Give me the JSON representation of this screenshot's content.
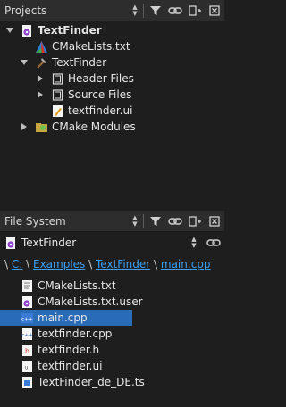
{
  "projects_toolbar": {
    "title": "Projects"
  },
  "project_tree": {
    "root": "TextFinder",
    "cmake_lists": "CMakeLists.txt",
    "target": "TextFinder",
    "header_files": "Header Files",
    "source_files": "Source Files",
    "ui_file": "textfinder.ui",
    "cmake_modules": "CMake Modules"
  },
  "fs_toolbar": {
    "title": "File System"
  },
  "fs_combo": {
    "value": "TextFinder"
  },
  "breadcrumb": {
    "root": "\\",
    "c": "C:",
    "examples": "Examples",
    "textfinder": "TextFinder",
    "file": "main.cpp",
    "sep": "\\"
  },
  "files": [
    {
      "name": "CMakeLists.txt",
      "icon": "cmake-file-icon"
    },
    {
      "name": "CMakeLists.txt.user",
      "icon": "xml-file-icon"
    },
    {
      "name": "main.cpp",
      "icon": "cpp-file-icon",
      "selected": true
    },
    {
      "name": "textfinder.cpp",
      "icon": "cpp-file-icon"
    },
    {
      "name": "textfinder.h",
      "icon": "header-file-icon"
    },
    {
      "name": "textfinder.ui",
      "icon": "ui-file-icon"
    },
    {
      "name": "TextFinder_de_DE.ts",
      "icon": "ts-file-icon"
    }
  ],
  "colors": {
    "selection": "#2a6bb8",
    "link": "#3a9ff5",
    "background": "#1e1e1e"
  }
}
